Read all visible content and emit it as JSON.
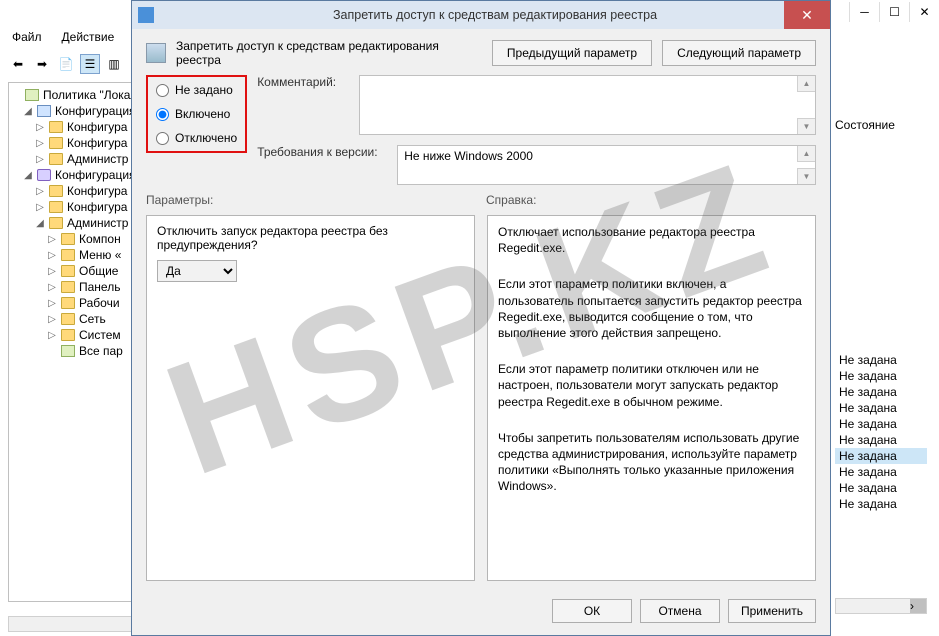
{
  "bg_window": {
    "menu": {
      "file": "Файл",
      "action": "Действие"
    },
    "tree": {
      "root": "Политика \"Локал",
      "cfg_computer": "Конфигурация",
      "cfg_c1": "Конфигура",
      "cfg_c2": "Конфигура",
      "cfg_c3": "Администр",
      "cfg_user": "Конфигурация",
      "cfg_u1": "Конфигура",
      "cfg_u2": "Конфигура",
      "cfg_u3": "Администр",
      "admin1": "Компон",
      "admin2": "Меню «",
      "admin3": "Общие",
      "admin4": "Панель",
      "admin5": "Рабочи",
      "admin6": "Сеть",
      "admin7": "Систем",
      "admin8": "Все пар"
    },
    "right_header": "Состояние",
    "state_value": "Не задана"
  },
  "dialog": {
    "title": "Запретить доступ к средствам редактирования реестра",
    "header_text": "Запретить доступ к средствам редактирования реестра",
    "prev_btn": "Предыдущий параметр",
    "next_btn": "Следующий параметр",
    "radio": {
      "not_configured": "Не задано",
      "enabled": "Включено",
      "disabled": "Отключено"
    },
    "comment_label": "Комментарий:",
    "requirement_label": "Требования к версии:",
    "requirement_value": "Не ниже Windows 2000",
    "params_label": "Параметры:",
    "help_label": "Справка:",
    "param_question": "Отключить запуск редактора реестра без предупреждения?",
    "param_options": {
      "yes": "Да"
    },
    "help_p1": "Отключает использование редактора реестра Regedit.exe.",
    "help_p2": "Если этот параметр политики включен, а пользователь попытается запустить редактор реестра Regedit.exe, выводится сообщение о том, что выполнение этого действия запрещено.",
    "help_p3": "Если этот параметр политики отключен или не настроен, пользователи могут запускать редактор реестра Regedit.exe в обычном режиме.",
    "help_p4": "Чтобы запретить пользователям использовать другие средства администрирования, используйте параметр политики «Выполнять только указанные приложения Windows».",
    "ok": "ОК",
    "cancel": "Отмена",
    "apply": "Применить"
  }
}
